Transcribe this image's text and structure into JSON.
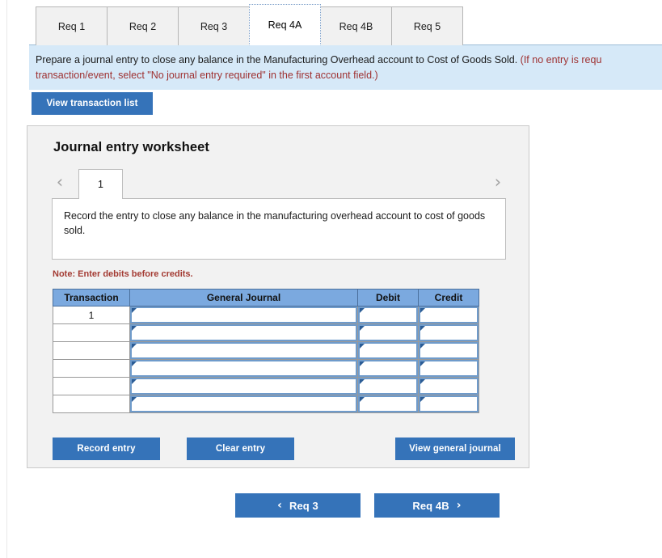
{
  "tabs": [
    {
      "label": "Req 1",
      "active": false
    },
    {
      "label": "Req 2",
      "active": false
    },
    {
      "label": "Req 3",
      "active": false
    },
    {
      "label": "Req 4A",
      "active": true
    },
    {
      "label": "Req 4B",
      "active": false
    },
    {
      "label": "Req 5",
      "active": false
    }
  ],
  "instruction": {
    "line1_main": "Prepare a journal entry to close any balance in the Manufacturing Overhead account to Cost of Goods Sold. ",
    "line1_red": "(If no entry is requ",
    "line2_red": "transaction/event, select \"No journal entry required\" in the first account field.)"
  },
  "toolbar": {
    "view_transaction_list": "View transaction list"
  },
  "worksheet": {
    "title": "Journal entry worksheet",
    "pager": {
      "prev_icon": "chevron-left",
      "next_icon": "chevron-right",
      "current_page": "1"
    },
    "description": "Record the entry to close any balance in the manufacturing overhead account to cost of goods sold.",
    "note": "Note: Enter debits before credits.",
    "table": {
      "headers": [
        "Transaction",
        "General Journal",
        "Debit",
        "Credit"
      ],
      "rows": [
        {
          "transaction": "1",
          "general_journal": "",
          "debit": "",
          "credit": ""
        },
        {
          "transaction": "",
          "general_journal": "",
          "debit": "",
          "credit": ""
        },
        {
          "transaction": "",
          "general_journal": "",
          "debit": "",
          "credit": ""
        },
        {
          "transaction": "",
          "general_journal": "",
          "debit": "",
          "credit": ""
        },
        {
          "transaction": "",
          "general_journal": "",
          "debit": "",
          "credit": ""
        },
        {
          "transaction": "",
          "general_journal": "",
          "debit": "",
          "credit": ""
        }
      ]
    },
    "actions": {
      "record_entry": "Record entry",
      "clear_entry": "Clear entry",
      "view_general_journal": "View general journal"
    }
  },
  "navigation": {
    "prev_label": "Req 3",
    "prev_icon": "chevron-left",
    "next_label": "Req 4B",
    "next_icon": "chevron-right"
  },
  "colors": {
    "accent_blue": "#3573b9",
    "table_header_blue": "#7ba9df",
    "banner_blue": "#d6e9f8",
    "note_red": "#a33a32",
    "panel_gray": "#f2f2f2"
  }
}
